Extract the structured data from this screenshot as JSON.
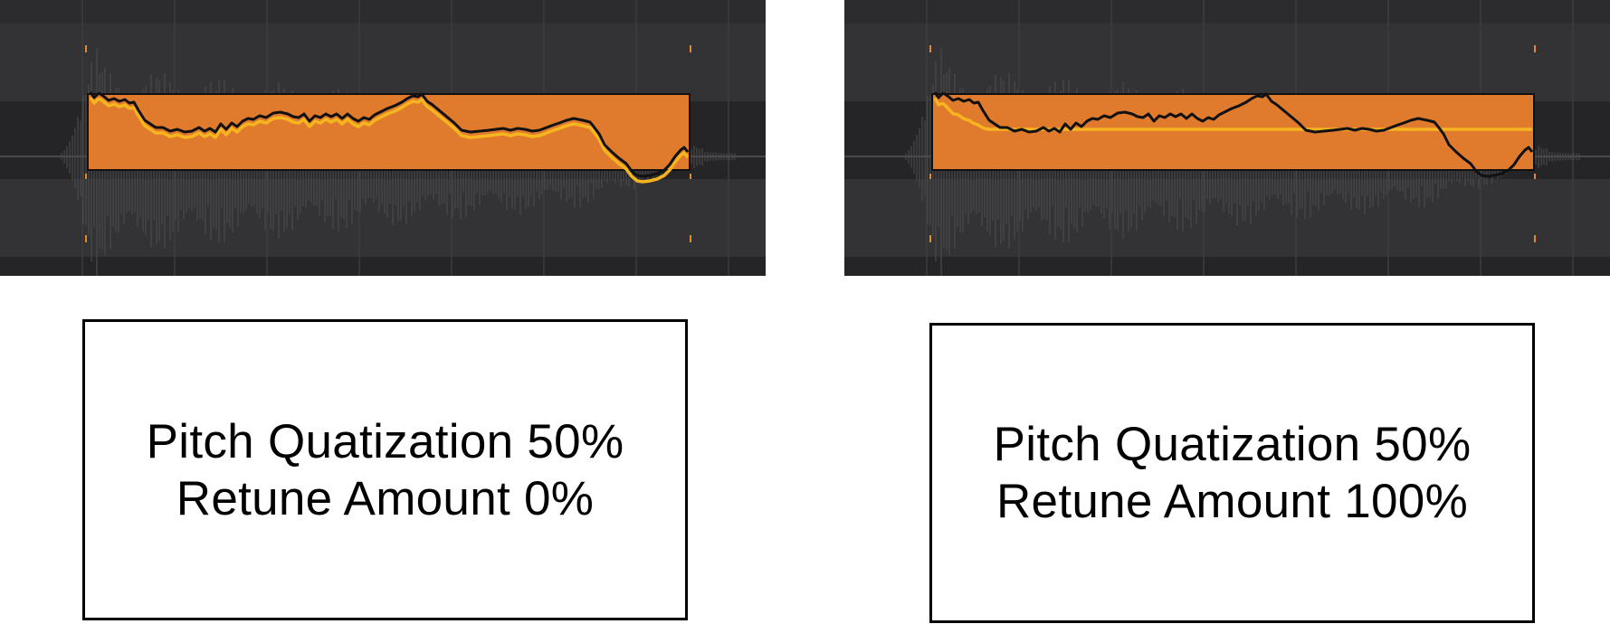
{
  "colors": {
    "background": "#2c2c2e",
    "band_dark": "#252527",
    "band_light": "#333335",
    "gridline": "#3c3c3e",
    "waveform": "#4a4a4c",
    "note_fill": "#e07b2e",
    "note_border": "#111111",
    "original_pitch": "#111111",
    "retuned_pitch": "#f6b51e",
    "marker": "#e08a2a"
  },
  "panels": [
    {
      "retune_amount": 0,
      "caption": {
        "line1": "Pitch Quatization 50%",
        "line2": "Retune Amount 0%"
      }
    },
    {
      "retune_amount": 100,
      "caption": {
        "line1": "Pitch Quatization 50%",
        "line2": "Retune Amount 100%"
      }
    }
  ]
}
